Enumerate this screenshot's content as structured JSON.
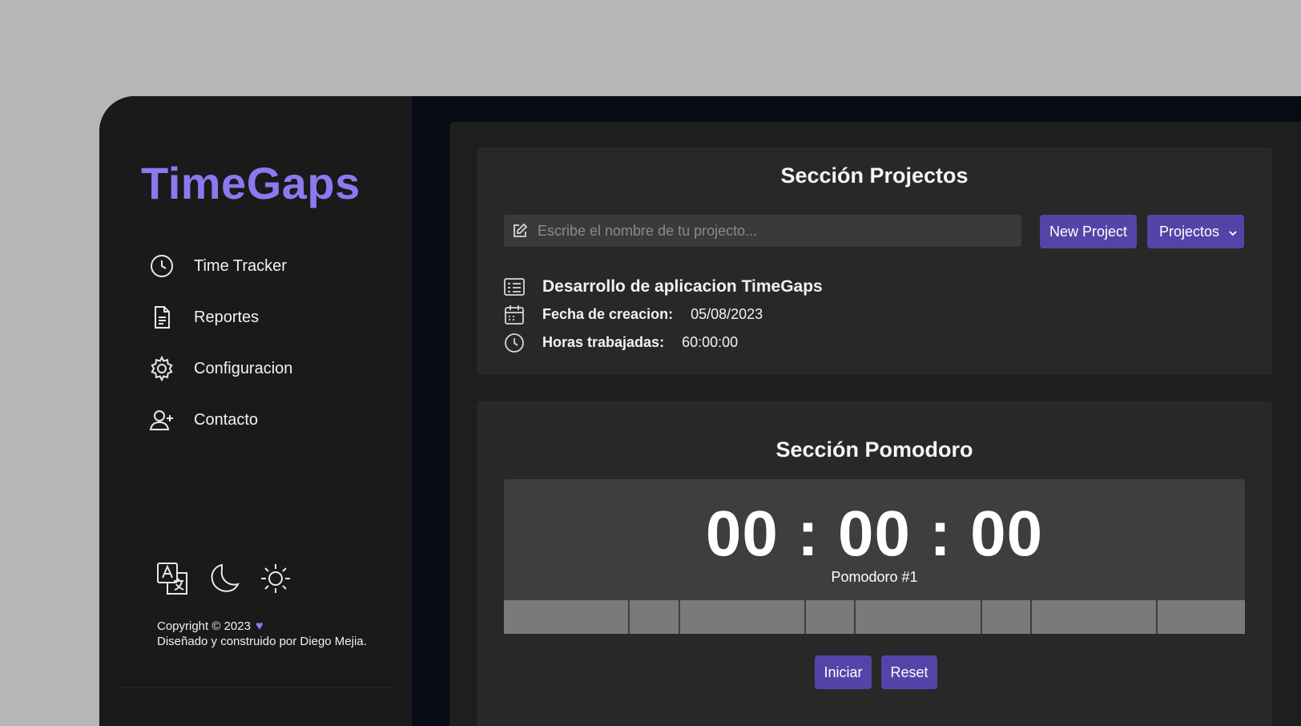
{
  "brand": {
    "name": "TimeGaps",
    "accent": "#8a7af0",
    "button": "#5345a8"
  },
  "sidebar": {
    "items": [
      {
        "label": "Time Tracker",
        "icon": "clock-icon"
      },
      {
        "label": "Reportes",
        "icon": "document-icon"
      },
      {
        "label": "Configuracion",
        "icon": "gear-icon"
      },
      {
        "label": "Contacto",
        "icon": "add-user-icon"
      }
    ],
    "bottom_icons": [
      "translate-icon",
      "moon-icon",
      "sun-icon"
    ],
    "footer": {
      "copyright": "Copyright © 2023",
      "credit": "Diseñado y construido por Diego Mejia."
    }
  },
  "projects": {
    "title": "Sección Projectos",
    "input_placeholder": "Escribe el nombre de tu projecto...",
    "input_value": "",
    "new_button": "New Project",
    "select_label": "Projectos",
    "project_name": "Desarrollo de aplicacion TimeGaps",
    "created_label": "Fecha de creacion:",
    "created_value": "05/08/2023",
    "hours_label": "Horas trabajadas:",
    "hours_value": "60:00:00"
  },
  "pomodoro": {
    "title": "Sección Pomodoro",
    "timer": "00 : 00 : 00",
    "label": "Pomodoro #1",
    "segments": [
      "work",
      "break",
      "work",
      "break",
      "work",
      "break",
      "work",
      "long-break"
    ],
    "start_button": "Iniciar",
    "reset_button": "Reset"
  }
}
